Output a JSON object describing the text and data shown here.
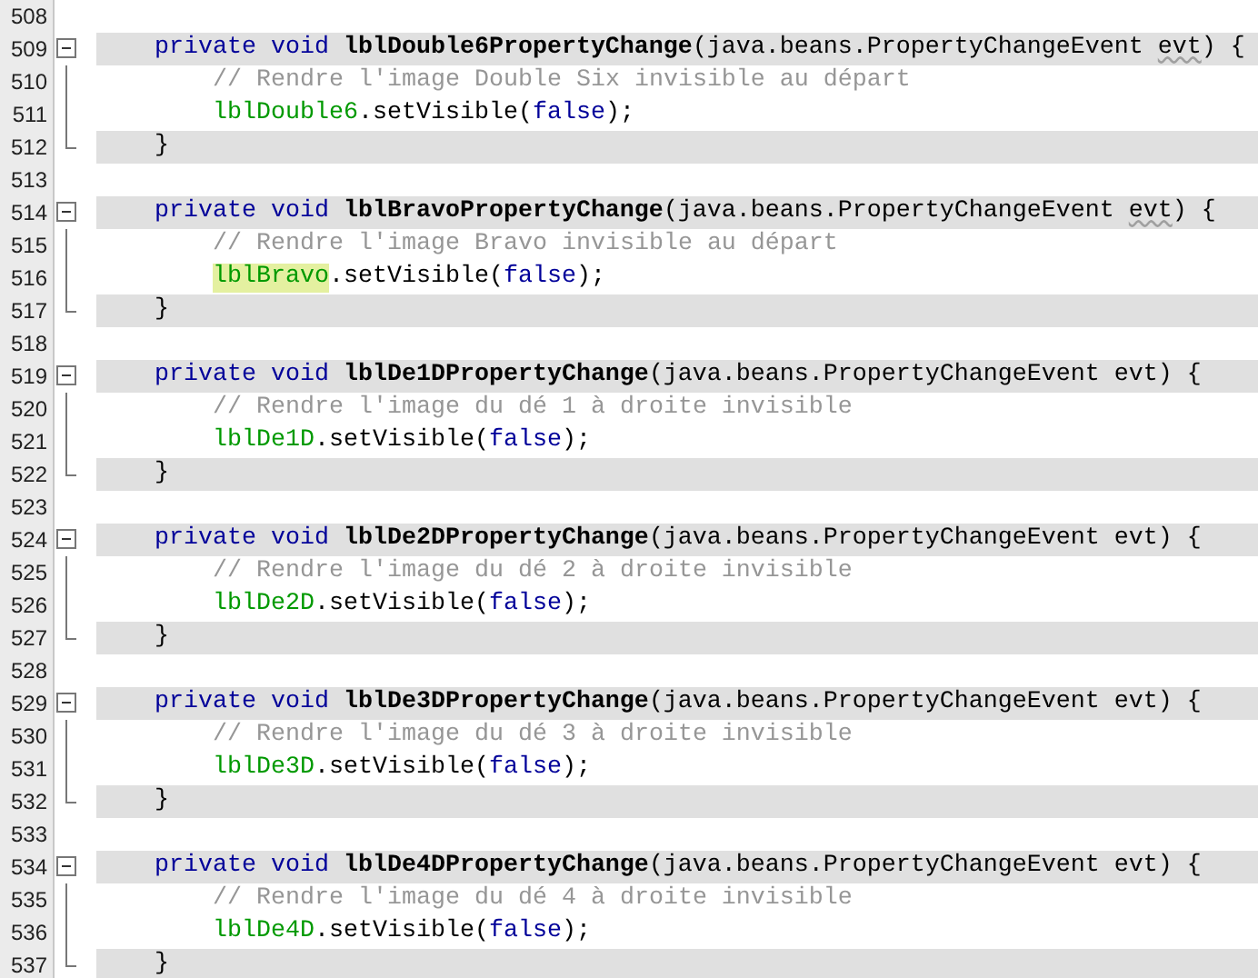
{
  "editor": {
    "lines": [
      {
        "number": "508",
        "kind": "blank",
        "band": false
      },
      {
        "number": "509",
        "kind": "declaration",
        "band": true,
        "segments": [
          {
            "kind": "keyword",
            "text": "private void"
          },
          {
            "kind": "method",
            "text": "lblDouble6PropertyChange"
          },
          {
            "kind": "plain",
            "text": "(java.beans.PropertyChangeEvent "
          },
          {
            "kind": "warning",
            "text": "evt"
          },
          {
            "kind": "plain",
            "text": ") {"
          }
        ]
      },
      {
        "number": "510",
        "kind": "body",
        "band": false,
        "segments": [
          {
            "kind": "comment",
            "text": "// Rendre l'image Double Six invisible au départ"
          }
        ]
      },
      {
        "number": "511",
        "kind": "body",
        "band": false,
        "segments": [
          {
            "kind": "field",
            "text": "lblDouble6"
          },
          {
            "kind": "plain",
            "text": ".setVisible("
          },
          {
            "kind": "literal",
            "text": "false"
          },
          {
            "kind": "plain",
            "text": ");"
          }
        ]
      },
      {
        "number": "512",
        "kind": "closing",
        "band": true,
        "segments": [
          {
            "kind": "plain",
            "text": "}"
          }
        ]
      },
      {
        "number": "513",
        "kind": "blank",
        "band": false
      },
      {
        "number": "514",
        "kind": "declaration",
        "band": true,
        "segments": [
          {
            "kind": "keyword",
            "text": "private void"
          },
          {
            "kind": "method",
            "text": "lblBravoPropertyChange"
          },
          {
            "kind": "plain",
            "text": "(java.beans.PropertyChangeEvent "
          },
          {
            "kind": "warning",
            "text": "evt"
          },
          {
            "kind": "plain",
            "text": ") {"
          }
        ]
      },
      {
        "number": "515",
        "kind": "body",
        "band": false,
        "segments": [
          {
            "kind": "comment",
            "text": "// Rendre l'image Bravo invisible au départ"
          }
        ]
      },
      {
        "number": "516",
        "kind": "body",
        "band": false,
        "segments": [
          {
            "kind": "occurrence",
            "text": "lblBravo"
          },
          {
            "kind": "plain",
            "text": ".setVisible("
          },
          {
            "kind": "literal",
            "text": "false"
          },
          {
            "kind": "plain",
            "text": ");"
          }
        ]
      },
      {
        "number": "517",
        "kind": "closing",
        "band": true,
        "segments": [
          {
            "kind": "plain",
            "text": "}"
          }
        ]
      },
      {
        "number": "518",
        "kind": "blank",
        "band": false
      },
      {
        "number": "519",
        "kind": "declaration",
        "band": true,
        "segments": [
          {
            "kind": "keyword",
            "text": "private void"
          },
          {
            "kind": "method",
            "text": "lblDe1DPropertyChange"
          },
          {
            "kind": "plain",
            "text": "(java.beans.PropertyChangeEvent evt) {"
          }
        ]
      },
      {
        "number": "520",
        "kind": "body",
        "band": false,
        "segments": [
          {
            "kind": "comment",
            "text": "// Rendre l'image du dé 1 à droite invisible"
          }
        ]
      },
      {
        "number": "521",
        "kind": "body",
        "band": false,
        "segments": [
          {
            "kind": "field",
            "text": "lblDe1D"
          },
          {
            "kind": "plain",
            "text": ".setVisible("
          },
          {
            "kind": "literal",
            "text": "false"
          },
          {
            "kind": "plain",
            "text": ");"
          }
        ]
      },
      {
        "number": "522",
        "kind": "closing",
        "band": true,
        "segments": [
          {
            "kind": "plain",
            "text": "}"
          }
        ]
      },
      {
        "number": "523",
        "kind": "blank",
        "band": false
      },
      {
        "number": "524",
        "kind": "declaration",
        "band": true,
        "segments": [
          {
            "kind": "keyword",
            "text": "private void"
          },
          {
            "kind": "method",
            "text": "lblDe2DPropertyChange"
          },
          {
            "kind": "plain",
            "text": "(java.beans.PropertyChangeEvent evt) {"
          }
        ]
      },
      {
        "number": "525",
        "kind": "body",
        "band": false,
        "segments": [
          {
            "kind": "comment",
            "text": "// Rendre l'image du dé 2 à droite invisible"
          }
        ]
      },
      {
        "number": "526",
        "kind": "body",
        "band": false,
        "segments": [
          {
            "kind": "field",
            "text": "lblDe2D"
          },
          {
            "kind": "plain",
            "text": ".setVisible("
          },
          {
            "kind": "literal",
            "text": "false"
          },
          {
            "kind": "plain",
            "text": ");"
          }
        ]
      },
      {
        "number": "527",
        "kind": "closing",
        "band": true,
        "segments": [
          {
            "kind": "plain",
            "text": "}"
          }
        ]
      },
      {
        "number": "528",
        "kind": "blank",
        "band": false
      },
      {
        "number": "529",
        "kind": "declaration",
        "band": true,
        "segments": [
          {
            "kind": "keyword",
            "text": "private void"
          },
          {
            "kind": "method",
            "text": "lblDe3DPropertyChange"
          },
          {
            "kind": "plain",
            "text": "(java.beans.PropertyChangeEvent evt) {"
          }
        ]
      },
      {
        "number": "530",
        "kind": "body",
        "band": false,
        "segments": [
          {
            "kind": "comment",
            "text": "// Rendre l'image du dé 3 à droite invisible"
          }
        ]
      },
      {
        "number": "531",
        "kind": "body",
        "band": false,
        "segments": [
          {
            "kind": "field",
            "text": "lblDe3D"
          },
          {
            "kind": "plain",
            "text": ".setVisible("
          },
          {
            "kind": "literal",
            "text": "false"
          },
          {
            "kind": "plain",
            "text": ");"
          }
        ]
      },
      {
        "number": "532",
        "kind": "closing",
        "band": true,
        "segments": [
          {
            "kind": "plain",
            "text": "}"
          }
        ]
      },
      {
        "number": "533",
        "kind": "blank",
        "band": false
      },
      {
        "number": "534",
        "kind": "declaration",
        "band": true,
        "segments": [
          {
            "kind": "keyword",
            "text": "private void"
          },
          {
            "kind": "method",
            "text": "lblDe4DPropertyChange"
          },
          {
            "kind": "plain",
            "text": "(java.beans.PropertyChangeEvent evt) {"
          }
        ]
      },
      {
        "number": "535",
        "kind": "body",
        "band": false,
        "segments": [
          {
            "kind": "comment",
            "text": "// Rendre l'image du dé 4 à droite invisible"
          }
        ]
      },
      {
        "number": "536",
        "kind": "body",
        "band": false,
        "segments": [
          {
            "kind": "field",
            "text": "lblDe4D"
          },
          {
            "kind": "plain",
            "text": ".setVisible("
          },
          {
            "kind": "literal",
            "text": "false"
          },
          {
            "kind": "plain",
            "text": ");"
          }
        ]
      },
      {
        "number": "537",
        "kind": "closing",
        "band": true,
        "segments": [
          {
            "kind": "plain",
            "text": "}"
          }
        ]
      }
    ]
  }
}
